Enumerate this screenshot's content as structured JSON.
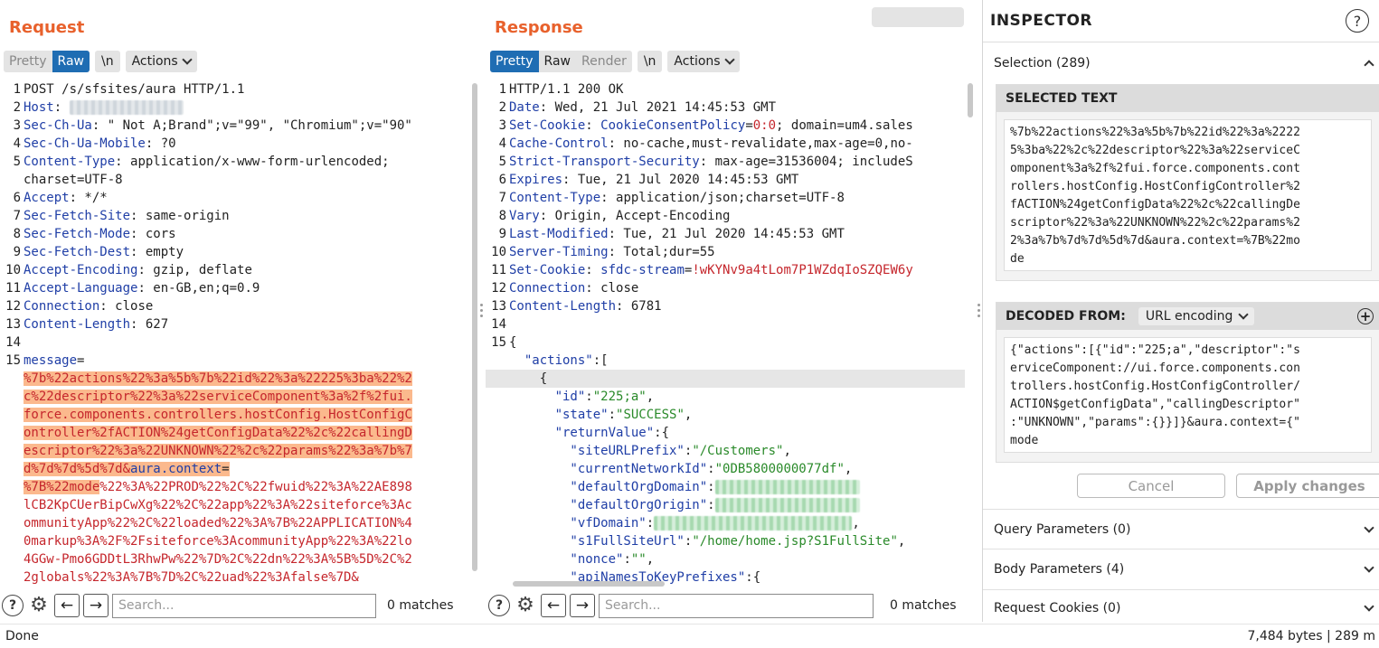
{
  "request": {
    "title": "Request",
    "tabs": [
      "Pretty",
      "Raw"
    ],
    "active_tab": "Raw",
    "newline_label": "\\n",
    "actions_label": "Actions",
    "lines": [
      {
        "n": "1",
        "parts": [
          {
            "t": "POST /s/sfsites/aura HTTP/1.1",
            "c": "hv"
          }
        ]
      },
      {
        "n": "2",
        "parts": [
          {
            "t": "Host",
            "c": "hk"
          },
          {
            "t": ": ",
            "c": "hv"
          },
          {
            "t": "help.██████.com",
            "c": "blur"
          }
        ]
      },
      {
        "n": "3",
        "parts": [
          {
            "t": "Sec-Ch-Ua",
            "c": "hk"
          },
          {
            "t": ": \" Not A;Brand\";v=\"99\", \"Chromium\";v=\"90\"",
            "c": "hv"
          }
        ]
      },
      {
        "n": "4",
        "parts": [
          {
            "t": "Sec-Ch-Ua-Mobile",
            "c": "hk"
          },
          {
            "t": ": ?0",
            "c": "hv"
          }
        ]
      },
      {
        "n": "5",
        "parts": [
          {
            "t": "Content-Type",
            "c": "hk"
          },
          {
            "t": ": application/x-www-form-urlencoded;",
            "c": "hv"
          }
        ]
      },
      {
        "n": "",
        "parts": [
          {
            "t": "charset=UTF-8",
            "c": "hv"
          }
        ]
      },
      {
        "n": "6",
        "parts": [
          {
            "t": "Accept",
            "c": "hk"
          },
          {
            "t": ": */*",
            "c": "hv"
          }
        ]
      },
      {
        "n": "7",
        "parts": [
          {
            "t": "Sec-Fetch-Site",
            "c": "hk"
          },
          {
            "t": ": same-origin",
            "c": "hv"
          }
        ]
      },
      {
        "n": "8",
        "parts": [
          {
            "t": "Sec-Fetch-Mode",
            "c": "hk"
          },
          {
            "t": ": cors",
            "c": "hv"
          }
        ]
      },
      {
        "n": "9",
        "parts": [
          {
            "t": "Sec-Fetch-Dest",
            "c": "hk"
          },
          {
            "t": ": empty",
            "c": "hv"
          }
        ]
      },
      {
        "n": "10",
        "parts": [
          {
            "t": "Accept-Encoding",
            "c": "hk"
          },
          {
            "t": ": gzip, deflate",
            "c": "hv"
          }
        ]
      },
      {
        "n": "11",
        "parts": [
          {
            "t": "Accept-Language",
            "c": "hk"
          },
          {
            "t": ": en-GB,en;q=0.9",
            "c": "hv"
          }
        ]
      },
      {
        "n": "12",
        "parts": [
          {
            "t": "Connection",
            "c": "hk"
          },
          {
            "t": ": close",
            "c": "hv"
          }
        ]
      },
      {
        "n": "13",
        "parts": [
          {
            "t": "Content-Length",
            "c": "hk"
          },
          {
            "t": ": 627",
            "c": "hv"
          }
        ]
      },
      {
        "n": "14",
        "parts": [
          {
            "t": "",
            "c": "hv"
          }
        ]
      },
      {
        "n": "15",
        "parts": [
          {
            "t": "message",
            "c": "blue"
          },
          {
            "t": "=",
            "c": "hv"
          }
        ]
      },
      {
        "n": "",
        "parts": [
          {
            "t": "%7b%22actions%22%3a%5b%7b%22id%22%3a%22225%3ba%22%2",
            "c": "red hl"
          }
        ]
      },
      {
        "n": "",
        "parts": [
          {
            "t": "c%22descriptor%22%3a%22serviceComponent%3a%2f%2fui.",
            "c": "red hl"
          }
        ]
      },
      {
        "n": "",
        "parts": [
          {
            "t": "force.components.controllers.hostConfig.HostConfigC",
            "c": "red hl"
          }
        ]
      },
      {
        "n": "",
        "parts": [
          {
            "t": "ontroller%2fACTION%24getConfigData%22%2c%22callingD",
            "c": "red hl"
          }
        ]
      },
      {
        "n": "",
        "parts": [
          {
            "t": "escriptor%22%3a%22UNKNOWN%22%2c%22params%22%3a%7b%7",
            "c": "red hl"
          }
        ]
      },
      {
        "n": "",
        "parts": [
          {
            "t": "d%7d%7d%5d%7d&",
            "c": "red hl"
          },
          {
            "t": "aura.context",
            "c": "blue hl"
          },
          {
            "t": "=",
            "c": "hv hl"
          }
        ]
      },
      {
        "n": "",
        "parts": [
          {
            "t": "%7B%22mode",
            "c": "red hl"
          },
          {
            "t": "%22%3A%22PROD%22%2C%22fwuid%22%3A%22AE898",
            "c": "red"
          }
        ]
      },
      {
        "n": "",
        "parts": [
          {
            "t": "lCB2KpCUerBipCwXg%22%2C%22app%22%3A%22siteforce%3Ac",
            "c": "red"
          }
        ]
      },
      {
        "n": "",
        "parts": [
          {
            "t": "ommunityApp%22%2C%22loaded%22%3A%7B%22APPLICATION%4",
            "c": "red"
          }
        ]
      },
      {
        "n": "",
        "parts": [
          {
            "t": "0markup%3A%2F%2Fsiteforce%3AcommunityApp%22%3A%22lo",
            "c": "red"
          }
        ]
      },
      {
        "n": "",
        "parts": [
          {
            "t": "4GGw-Pmo6GDDtL3RhwPw%22%7D%2C%22dn%22%3A%5B%5D%2C%2",
            "c": "red"
          }
        ]
      },
      {
        "n": "",
        "parts": [
          {
            "t": "2globals%22%3A%7B%7D%2C%22uad%22%3Afalse%7D&",
            "c": "red"
          }
        ]
      }
    ],
    "search_placeholder": "Search...",
    "matches": "0 matches"
  },
  "response": {
    "title": "Response",
    "tabs": [
      "Pretty",
      "Raw",
      "Render"
    ],
    "active_tab": "Pretty",
    "newline_label": "\\n",
    "actions_label": "Actions",
    "lines": [
      {
        "n": "1",
        "parts": [
          {
            "t": "HTTP/1.1 200 OK",
            "c": "hv"
          }
        ]
      },
      {
        "n": "2",
        "parts": [
          {
            "t": "Date",
            "c": "hk"
          },
          {
            "t": ": Wed, 21 Jul 2021 14:45:53 GMT",
            "c": "hv"
          }
        ]
      },
      {
        "n": "3",
        "parts": [
          {
            "t": "Set-Cookie",
            "c": "hk"
          },
          {
            "t": ": ",
            "c": "hv"
          },
          {
            "t": "CookieConsentPolicy",
            "c": "blue"
          },
          {
            "t": "=",
            "c": "hv"
          },
          {
            "t": "0:0",
            "c": "red"
          },
          {
            "t": "; domain=um4.sales",
            "c": "hv"
          }
        ]
      },
      {
        "n": "4",
        "parts": [
          {
            "t": "Cache-Control",
            "c": "hk"
          },
          {
            "t": ": no-cache,must-revalidate,max-age=0,no-",
            "c": "hv"
          }
        ]
      },
      {
        "n": "5",
        "parts": [
          {
            "t": "Strict-Transport-Security",
            "c": "hk"
          },
          {
            "t": ": max-age=31536004; includeS",
            "c": "hv"
          }
        ]
      },
      {
        "n": "6",
        "parts": [
          {
            "t": "Expires",
            "c": "hk"
          },
          {
            "t": ": Tue, 21 Jul 2020 14:45:53 GMT",
            "c": "hv"
          }
        ]
      },
      {
        "n": "7",
        "parts": [
          {
            "t": "Content-Type",
            "c": "hk"
          },
          {
            "t": ": application/json;charset=UTF-8",
            "c": "hv"
          }
        ]
      },
      {
        "n": "8",
        "parts": [
          {
            "t": "Vary",
            "c": "hk"
          },
          {
            "t": ": Origin, Accept-Encoding",
            "c": "hv"
          }
        ]
      },
      {
        "n": "9",
        "parts": [
          {
            "t": "Last-Modified",
            "c": "hk"
          },
          {
            "t": ": Tue, 21 Jul 2020 14:45:53 GMT",
            "c": "hv"
          }
        ]
      },
      {
        "n": "10",
        "parts": [
          {
            "t": "Server-Timing",
            "c": "hk"
          },
          {
            "t": ": Total;dur=55",
            "c": "hv"
          }
        ]
      },
      {
        "n": "11",
        "parts": [
          {
            "t": "Set-Cookie",
            "c": "hk"
          },
          {
            "t": ": ",
            "c": "hv"
          },
          {
            "t": "sfdc-stream",
            "c": "blue"
          },
          {
            "t": "=",
            "c": "hv"
          },
          {
            "t": "!wKYNv9a4tLom7P1WZdqIoSZQEW6y",
            "c": "red"
          }
        ]
      },
      {
        "n": "12",
        "parts": [
          {
            "t": "Connection",
            "c": "hk"
          },
          {
            "t": ": close",
            "c": "hv"
          }
        ]
      },
      {
        "n": "13",
        "parts": [
          {
            "t": "Content-Length",
            "c": "hk"
          },
          {
            "t": ": 6781",
            "c": "hv"
          }
        ]
      },
      {
        "n": "14",
        "parts": [
          {
            "t": "",
            "c": "hv"
          }
        ]
      },
      {
        "n": "15",
        "parts": [
          {
            "t": "{",
            "c": "jp"
          }
        ]
      },
      {
        "n": "",
        "parts": [
          {
            "t": "  \"actions\"",
            "c": "jk"
          },
          {
            "t": ":[",
            "c": "jp"
          }
        ]
      },
      {
        "n": "",
        "sel": true,
        "parts": [
          {
            "t": "    {",
            "c": "jp"
          }
        ]
      },
      {
        "n": "",
        "parts": [
          {
            "t": "      \"id\"",
            "c": "jk"
          },
          {
            "t": ":",
            "c": "jp"
          },
          {
            "t": "\"225;a\"",
            "c": "js"
          },
          {
            "t": ",",
            "c": "jp"
          }
        ]
      },
      {
        "n": "",
        "parts": [
          {
            "t": "      \"state\"",
            "c": "jk"
          },
          {
            "t": ":",
            "c": "jp"
          },
          {
            "t": "\"SUCCESS\"",
            "c": "js"
          },
          {
            "t": ",",
            "c": "jp"
          }
        ]
      },
      {
        "n": "",
        "parts": [
          {
            "t": "      \"returnValue\"",
            "c": "jk"
          },
          {
            "t": ":{",
            "c": "jp"
          }
        ]
      },
      {
        "n": "",
        "parts": [
          {
            "t": "        \"siteURLPrefix\"",
            "c": "jk"
          },
          {
            "t": ":",
            "c": "jp"
          },
          {
            "t": "\"/Customers\"",
            "c": "js"
          },
          {
            "t": ",",
            "c": "jp"
          }
        ]
      },
      {
        "n": "",
        "parts": [
          {
            "t": "        \"currentNetworkId\"",
            "c": "jk"
          },
          {
            "t": ":",
            "c": "jp"
          },
          {
            "t": "\"0DB5800000077df\"",
            "c": "js"
          },
          {
            "t": ",",
            "c": "jp"
          }
        ]
      },
      {
        "n": "",
        "parts": [
          {
            "t": "        \"defaultOrgDomain\"",
            "c": "jk"
          },
          {
            "t": ":",
            "c": "jp"
          },
          {
            "t": "\"██████████████████",
            "c": "blurg"
          }
        ]
      },
      {
        "n": "",
        "parts": [
          {
            "t": "        \"defaultOrgOrigin\"",
            "c": "jk"
          },
          {
            "t": ":",
            "c": "jp"
          },
          {
            "t": "\"██████████████████",
            "c": "blurg"
          }
        ]
      },
      {
        "n": "",
        "parts": [
          {
            "t": "        \"vfDomain\"",
            "c": "jk"
          },
          {
            "t": ":",
            "c": "jp"
          },
          {
            "t": "\"█████████████████████████",
            "c": "blurg"
          },
          {
            "t": ",",
            "c": "jp"
          }
        ]
      },
      {
        "n": "",
        "parts": [
          {
            "t": "        \"s1FullSiteUrl\"",
            "c": "jk"
          },
          {
            "t": ":",
            "c": "jp"
          },
          {
            "t": "\"/home/home.jsp?S1FullSite\"",
            "c": "js"
          },
          {
            "t": ",",
            "c": "jp"
          }
        ]
      },
      {
        "n": "",
        "parts": [
          {
            "t": "        \"nonce\"",
            "c": "jk"
          },
          {
            "t": ":",
            "c": "jp"
          },
          {
            "t": "\"\"",
            "c": "js"
          },
          {
            "t": ",",
            "c": "jp"
          }
        ]
      },
      {
        "n": "",
        "parts": [
          {
            "t": "        \"apiNamesToKeyPrefixes\"",
            "c": "jk"
          },
          {
            "t": ":{",
            "c": "jp"
          }
        ]
      }
    ],
    "search_placeholder": "Search...",
    "matches": "0 matches"
  },
  "inspector": {
    "title": "INSPECTOR",
    "selection_label": "Selection (289)",
    "selected_text_head": "SELECTED TEXT",
    "selected_text": "%7b%22actions%22%3a%5b%7b%22id%22%3a%2222\n5%3ba%22%2c%22descriptor%22%3a%22serviceC\nomponent%3a%2f%2fui.force.components.cont\nrollers.hostConfig.HostConfigController%2\nfACTION%24getConfigData%22%2c%22callingDe\nscriptor%22%3a%22UNKNOWN%22%2c%22params%2\n2%3a%7b%7d%7d%5d%7d&aura.context=%7B%22mo\nde",
    "decoded_from_head": "DECODED FROM:",
    "encoding": "URL encoding",
    "decoded_text": "{\"actions\":[{\"id\":\"225;a\",\"descriptor\":\"s\nerviceComponent://ui.force.components.con\ntrollers.hostConfig.HostConfigController/\nACTION$getConfigData\",\"callingDescriptor\"\n:\"UNKNOWN\",\"params\":{}}]}&aura.context={\"\nmode",
    "cancel_label": "Cancel",
    "apply_label": "Apply changes",
    "query_params": "Query Parameters (0)",
    "body_params": "Body Parameters (4)",
    "request_cookies": "Request Cookies (0)"
  },
  "status": {
    "left": "Done",
    "right": "7,484 bytes | 289 m"
  },
  "colors": {
    "accent": "#e8612c",
    "active_tab": "#1f6db3",
    "highlight": "#fbb98d"
  }
}
